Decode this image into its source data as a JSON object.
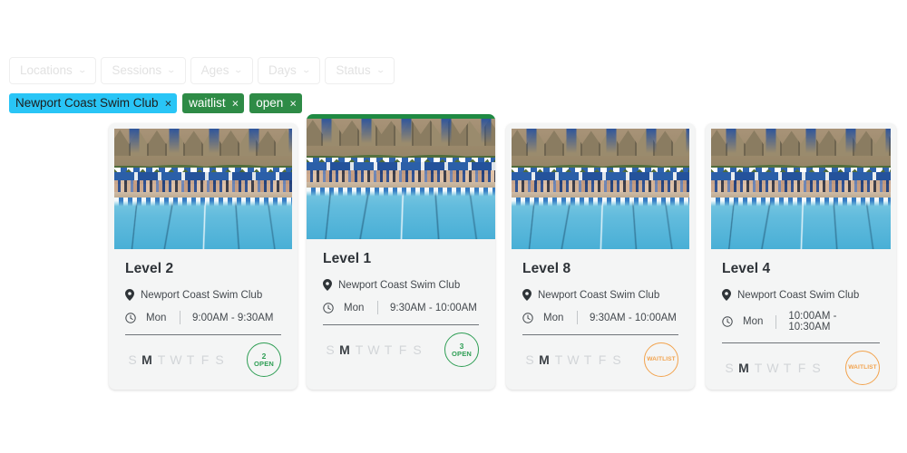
{
  "filters": {
    "buttons": [
      {
        "label": "Locations",
        "caret": "chevron-down-icon"
      },
      {
        "label": "Sessions",
        "caret": "chevron-down-icon"
      },
      {
        "label": "Ages",
        "caret": "chevron-down-icon"
      },
      {
        "label": "Days",
        "caret": "chevron-down-icon"
      },
      {
        "label": "Status",
        "caret": "chevron-down-icon"
      }
    ],
    "chips": [
      {
        "label": "Newport Coast Swim Club",
        "color": "#29c5f6",
        "text_color": "#1d1d1d",
        "remove": "×"
      },
      {
        "label": "waitlist",
        "color": "#2e8b46",
        "text_color": "#ffffff",
        "remove": "×"
      },
      {
        "label": "open",
        "color": "#2e8b46",
        "text_color": "#ffffff",
        "remove": "×"
      }
    ]
  },
  "colors": {
    "accent_green": "#1f8a43",
    "badge_open": "#2f9e55",
    "badge_waitlist": "#f2a34e",
    "chip_cyan": "#29c5f6",
    "chip_green": "#2e8b46",
    "card_bg": "#f4f5f5"
  },
  "day_letters": [
    "S",
    "M",
    "T",
    "W",
    "T",
    "F",
    "S"
  ],
  "cards": [
    {
      "title": "Level 2",
      "location": "Newport Coast Swim Club",
      "location_icon": "map-pin-icon",
      "clock_icon": "clock-icon",
      "day": "Mon",
      "time": "9:00AM - 9:30AM",
      "active_day_index": 1,
      "featured": false,
      "badge": {
        "kind": "open",
        "count": "2",
        "label": "OPEN"
      }
    },
    {
      "title": "Level 1",
      "location": "Newport Coast Swim Club",
      "location_icon": "map-pin-icon",
      "clock_icon": "clock-icon",
      "day": "Mon",
      "time": "9:30AM - 10:00AM",
      "active_day_index": 1,
      "featured": true,
      "badge": {
        "kind": "open",
        "count": "3",
        "label": "OPEN"
      }
    },
    {
      "title": "Level 8",
      "location": "Newport Coast Swim Club",
      "location_icon": "map-pin-icon",
      "clock_icon": "clock-icon",
      "day": "Mon",
      "time": "9:30AM - 10:00AM",
      "active_day_index": 1,
      "featured": false,
      "badge": {
        "kind": "waitlist",
        "count": "",
        "label": "WAITLIST"
      }
    },
    {
      "title": "Level 4",
      "location": "Newport Coast Swim Club",
      "location_icon": "map-pin-icon",
      "clock_icon": "clock-icon",
      "day": "Mon",
      "time": "10:00AM - 10:30AM",
      "active_day_index": 1,
      "featured": false,
      "badge": {
        "kind": "waitlist",
        "count": "",
        "label": "WAITLIST"
      }
    }
  ]
}
